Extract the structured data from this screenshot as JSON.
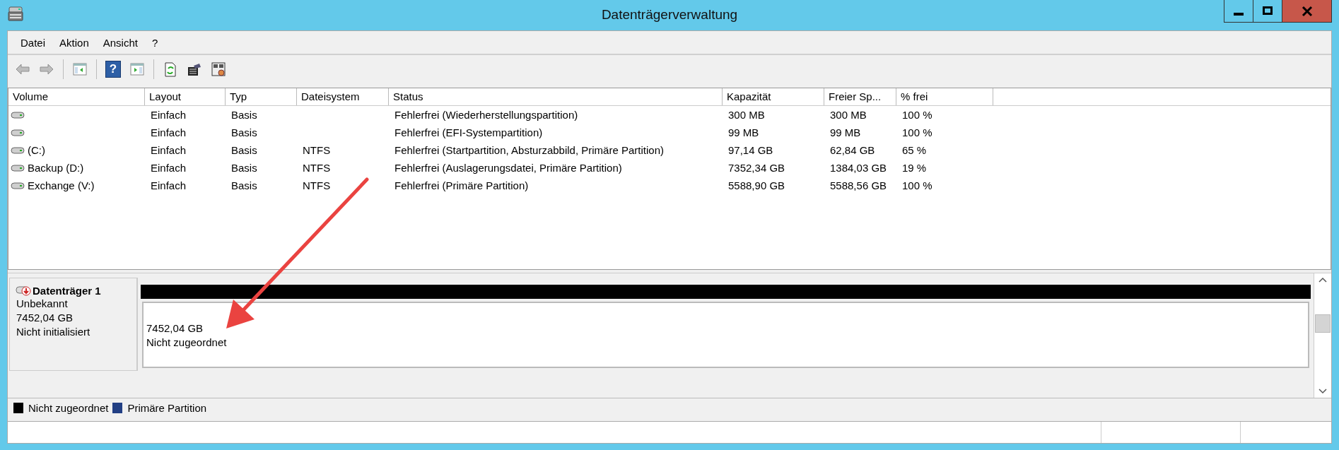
{
  "window": {
    "title": "Datenträgerverwaltung"
  },
  "menu": [
    "Datei",
    "Aktion",
    "Ansicht",
    "?"
  ],
  "toolbar": [
    {
      "kind": "back",
      "disabled": true
    },
    {
      "kind": "forward",
      "disabled": true
    },
    {
      "kind": "separator"
    },
    {
      "kind": "tree",
      "disabled": false
    },
    {
      "kind": "separator"
    },
    {
      "kind": "help",
      "glyph": "?",
      "disabled": false
    },
    {
      "kind": "pane",
      "disabled": false
    },
    {
      "kind": "separator"
    },
    {
      "kind": "refresh",
      "disabled": false
    },
    {
      "kind": "properties",
      "disabled": false
    },
    {
      "kind": "settings",
      "disabled": false
    }
  ],
  "table": {
    "columns": [
      "Volume",
      "Layout",
      "Typ",
      "Dateisystem",
      "Status",
      "Kapazität",
      "Freier Sp...",
      "% frei"
    ],
    "rows": [
      {
        "layout": "Einfach",
        "type": "Basis",
        "status": "Fehlerfrei (Wiederherstellungspartition)",
        "capacity": "300 MB",
        "free": "300 MB",
        "percent_free": "100 %"
      },
      {
        "layout": "Einfach",
        "type": "Basis",
        "status": "Fehlerfrei (EFI-Systempartition)",
        "capacity": "99 MB",
        "free": "99 MB",
        "percent_free": "100 %"
      },
      {
        "volume": "(C:)",
        "layout": "Einfach",
        "type": "Basis",
        "filesystem": "NTFS",
        "status": "Fehlerfrei (Startpartition, Absturzabbild, Primäre Partition)",
        "capacity": "97,14 GB",
        "free": "62,84 GB",
        "percent_free": "65 %"
      },
      {
        "volume": "Backup (D:)",
        "layout": "Einfach",
        "type": "Basis",
        "filesystem": "NTFS",
        "status": "Fehlerfrei (Auslagerungsdatei, Primäre Partition)",
        "capacity": "7352,34 GB",
        "free": "1384,03 GB",
        "percent_free": "19 %"
      },
      {
        "volume": "Exchange (V:)",
        "layout": "Einfach",
        "type": "Basis",
        "filesystem": "NTFS",
        "status": "Fehlerfrei (Primäre Partition)",
        "capacity": "5588,90 GB",
        "free": "5588,56 GB",
        "percent_free": "100 %"
      }
    ]
  },
  "disks": [
    {
      "name": "Datenträger 1",
      "type": "Unbekannt",
      "size": "7452,04 GB",
      "state": "Nicht initialisiert",
      "partitions": [
        {
          "size": "7452,04 GB",
          "label": "Nicht zugeordnet",
          "color": "#000000"
        }
      ]
    }
  ],
  "legend": [
    {
      "label": "Nicht zugeordnet",
      "color": "#000000"
    },
    {
      "label": "Primäre Partition",
      "color": "#223f84"
    }
  ]
}
